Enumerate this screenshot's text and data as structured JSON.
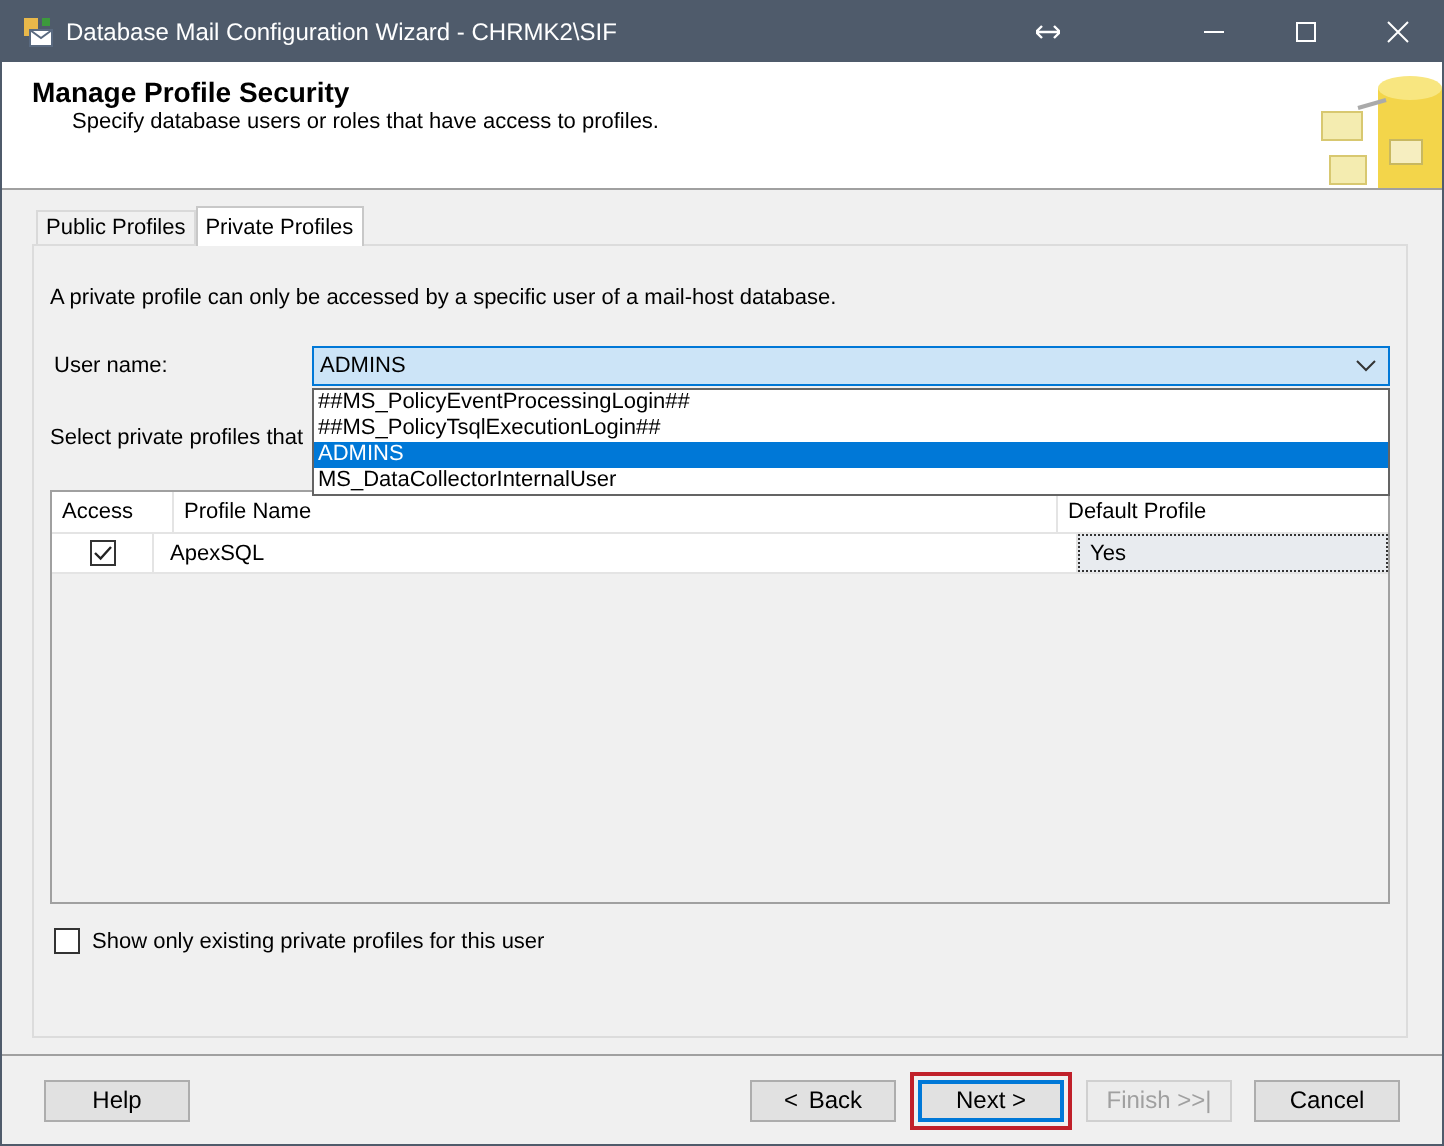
{
  "window": {
    "title": "Database Mail Configuration Wizard - CHRMK2\\SIF"
  },
  "header": {
    "title": "Manage Profile Security",
    "subtitle": "Specify database users or roles that have access to profiles."
  },
  "tabs": [
    {
      "label": "Public Profiles",
      "selected": false
    },
    {
      "label": "Private Profiles",
      "selected": true
    }
  ],
  "intro": "A private profile can only be accessed by a specific user of a mail-host database.",
  "user_name": {
    "label": "User name:",
    "value": "ADMINS",
    "expanded": true,
    "options": [
      {
        "label": "##MS_PolicyEventProcessingLogin##",
        "selected": false
      },
      {
        "label": "##MS_PolicyTsqlExecutionLogin##",
        "selected": false
      },
      {
        "label": "ADMINS",
        "selected": true
      },
      {
        "label": "MS_DataCollectorInternalUser",
        "selected": false
      }
    ]
  },
  "select_label": "Select private profiles that",
  "table": {
    "columns": [
      "Access",
      "Profile Name",
      "Default Profile"
    ],
    "rows": [
      {
        "access": true,
        "profile_name": "ApexSQL",
        "default_profile": "Yes"
      }
    ]
  },
  "show_existing": {
    "label": "Show only existing private profiles for this user",
    "checked": false
  },
  "buttons": [
    {
      "label": "Help",
      "kind": "plain",
      "disabled": false,
      "focused": false
    },
    {
      "label": "< Back",
      "kind": "spaced",
      "disabled": false,
      "focused": false
    },
    {
      "label": "Next >",
      "kind": "plain",
      "disabled": false,
      "focused": true
    },
    {
      "label": "Finish >>|",
      "kind": "plain",
      "disabled": true,
      "focused": false
    },
    {
      "label": "Cancel",
      "kind": "plain",
      "disabled": false,
      "focused": false
    }
  ]
}
